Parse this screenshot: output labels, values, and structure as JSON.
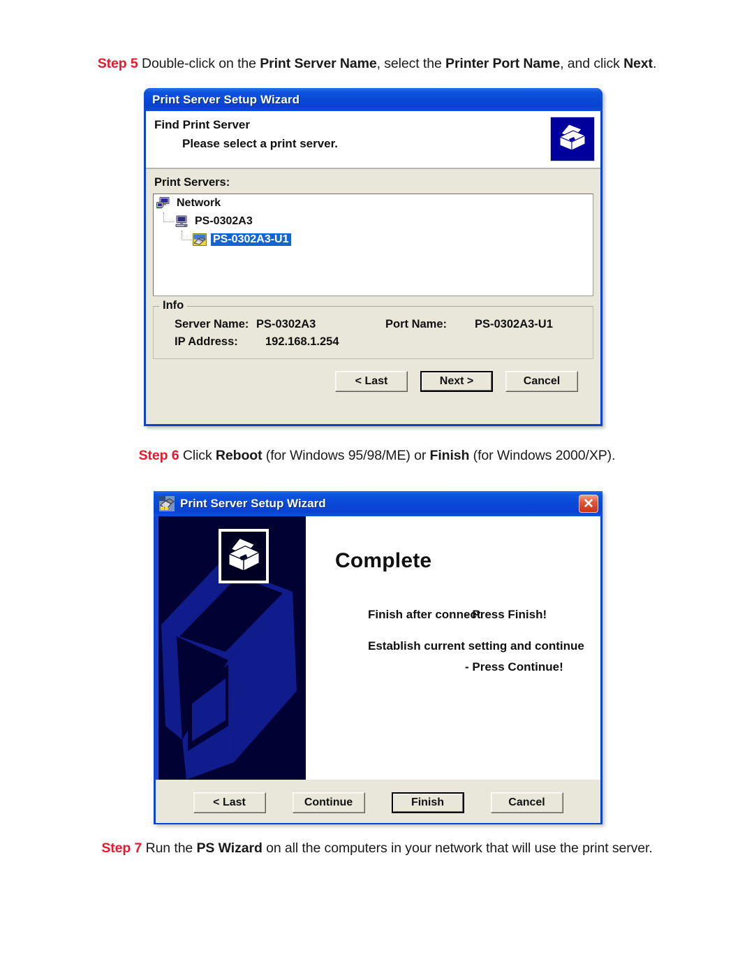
{
  "page": {
    "steps": [
      {
        "id": "step5",
        "label": "Step 5",
        "parts": [
          {
            "t": " Double-click on the ",
            "b": false
          },
          {
            "t": "Print Server Name",
            "b": true
          },
          {
            "t": ", select the ",
            "b": false
          },
          {
            "t": "Printer Port Name",
            "b": true
          },
          {
            "t": ", and click ",
            "b": false
          },
          {
            "t": "Next",
            "b": true
          },
          {
            "t": ".",
            "b": false
          }
        ]
      },
      {
        "id": "step6",
        "label": "Step 6",
        "parts": [
          {
            "t": " Click ",
            "b": false
          },
          {
            "t": "Reboot",
            "b": true
          },
          {
            "t": " (for Windows 95/98/ME) or ",
            "b": false
          },
          {
            "t": "Finish",
            "b": true
          },
          {
            "t": " (for Windows 2000/XP).",
            "b": false
          }
        ]
      },
      {
        "id": "step7",
        "label": "Step 7",
        "parts": [
          {
            "t": " Run the ",
            "b": false
          },
          {
            "t": "PS Wizard",
            "b": true
          },
          {
            "t": " on all the computers in your network that will use the print server.",
            "b": false
          }
        ]
      }
    ]
  },
  "colors": {
    "step_label": "#e8192c",
    "titlebar_blue": "#0a48d8",
    "dialog_face": "#e9e7da",
    "selection_blue": "#1464d2",
    "banner_navy": "#000033",
    "banner_accent": "#101c8c",
    "close_red": "#c63418"
  },
  "find_dialog": {
    "title": "Print Server Setup Wizard",
    "heading": "Find Print Server",
    "subheading": "Please select a print server.",
    "printer_icon": "printer-icon",
    "tree_label": "Print Servers:",
    "tree": [
      {
        "label": "Network",
        "level": 0,
        "icon": "network-icon",
        "selected": false
      },
      {
        "label": "PS-0302A3",
        "level": 1,
        "icon": "print-server-icon",
        "selected": false
      },
      {
        "label": "PS-0302A3-U1",
        "level": 2,
        "icon": "printer-port-icon",
        "selected": true
      }
    ],
    "info": {
      "legend": "Info",
      "server_name_label": "Server Name:",
      "server_name_value": "PS-0302A3",
      "port_name_label": "Port Name:",
      "port_name_value": "PS-0302A3-U1",
      "ip_label": "IP Address:",
      "ip_value": "192.168.1.254"
    },
    "buttons": {
      "last": "< Last",
      "next": "Next >",
      "cancel": "Cancel"
    }
  },
  "complete_dialog": {
    "title": "Print Server Setup Wizard",
    "window_icon": "print-server-wizard-icon",
    "close_glyph": "✕",
    "banner_icon": "printer-icon",
    "heading": "Complete",
    "line1_text": "Finish after connect",
    "line1_press": "- Press Finish!",
    "line2_text": "Establish current setting and continue",
    "line2_press": "- Press Continue!",
    "buttons": {
      "last": "< Last",
      "continue": "Continue",
      "finish": "Finish",
      "cancel": "Cancel"
    }
  }
}
